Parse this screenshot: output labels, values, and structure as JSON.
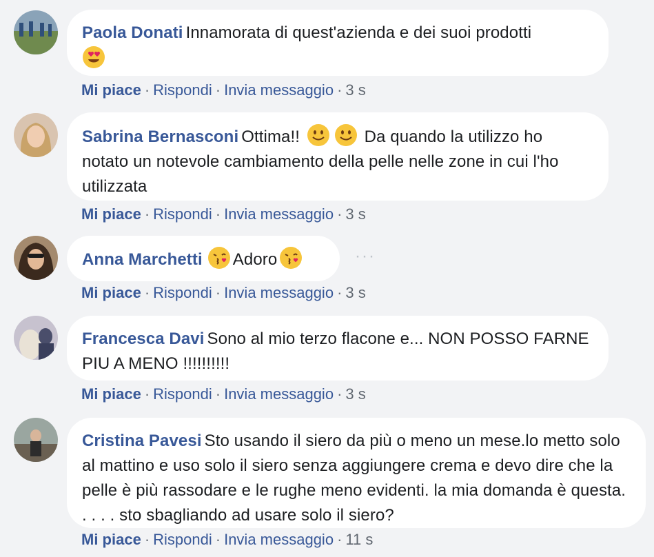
{
  "comments": [
    {
      "author": "Paola Donati",
      "text": "Innamorata di quest'azienda e dei suoi prodotti",
      "emoji_after": "heart-eyes-icon",
      "actions": {
        "like": "Mi piace",
        "reply": "Rispondi",
        "message": "Invia messaggio",
        "time": "3 s"
      }
    },
    {
      "author": "Sabrina Bernasconi",
      "text_before": "Ottima!!",
      "text_after": "Da quando la utilizzo ho notato un notevole cambiamento della pelle nelle zone in cui l'ho utilizzata",
      "emojis": [
        "smile-icon",
        "smile-icon"
      ],
      "actions": {
        "like": "Mi piace",
        "reply": "Rispondi",
        "message": "Invia messaggio",
        "time": "3 s"
      }
    },
    {
      "author": "Anna Marchetti",
      "text": "Adoro",
      "emojis": [
        "kiss-icon",
        "kiss-icon"
      ],
      "more": "···",
      "actions": {
        "like": "Mi piace",
        "reply": "Rispondi",
        "message": "Invia messaggio",
        "time": "3 s"
      }
    },
    {
      "author": "Francesca Davi",
      "text": "Sono al mio terzo flacone e... NON POSSO FARNE PIU A MENO !!!!!!!!!!",
      "actions": {
        "like": "Mi piace",
        "reply": "Rispondi",
        "message": "Invia messaggio",
        "time": "3 s"
      }
    },
    {
      "author": "Cristina Pavesi",
      "text": "Sto usando il siero da più o meno un mese.lo metto solo al mattino e uso solo il siero senza aggiungere crema e devo dire che la pelle è più rassodare e le rughe meno evidenti. la mia domanda è questa. . . . . sto sbagliando ad usare solo il siero?",
      "actions": {
        "like": "Mi piace",
        "reply": "Rispondi",
        "message": "Invia messaggio",
        "time": "11 s"
      }
    }
  ],
  "colors": {
    "background": "#f2f3f5",
    "bubble": "#ffffff",
    "author": "#385898",
    "meta": "#606770"
  }
}
